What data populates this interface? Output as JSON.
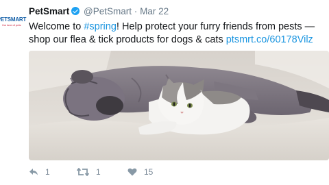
{
  "tweet": {
    "account": {
      "avatar_text": "PETSMART",
      "avatar_subtext": "the love of pets",
      "display_name": "PetSmart",
      "handle": "@PetSmart",
      "separator": "·",
      "date": "Mar 22",
      "verified": true
    },
    "text": {
      "part1": "Welcome to ",
      "hashtag": "#spring",
      "part2": "! Help protect your furry friends from pests — shop our flea & tick products for dogs & cats ",
      "link": "ptsmrt.co/60178Vilz"
    },
    "media": {
      "description_icon": "photo-dog-and-cat"
    },
    "actions": {
      "reply_count": "1",
      "retweet_count": "1",
      "like_count": "15"
    },
    "colors": {
      "link": "#1b95e0",
      "verified": "#1da1f2",
      "muted": "#657786"
    }
  }
}
